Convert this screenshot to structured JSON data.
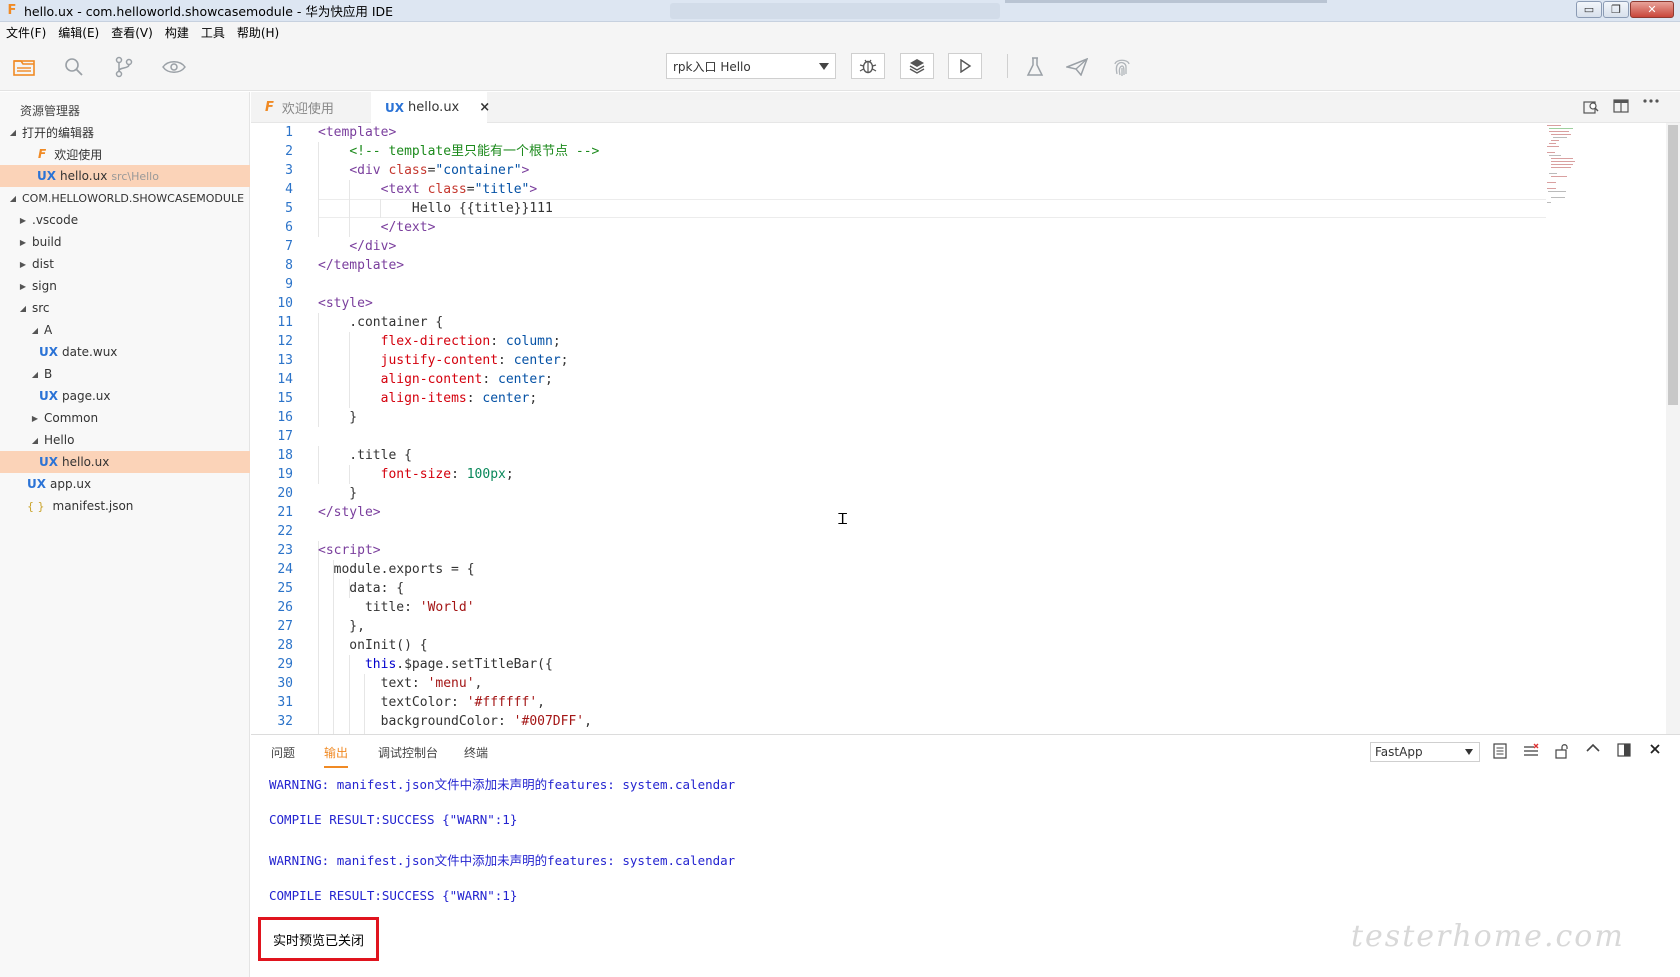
{
  "window": {
    "title": "hello.ux - com.helloworld.showcasemodule - 华为快应用 IDE",
    "app_icon": "F",
    "controls": {
      "minimize": "▭",
      "restore": "❐",
      "close": "✕"
    }
  },
  "menu": [
    "文件(F)",
    "编辑(E)",
    "查看(V)",
    "构建",
    "工具",
    "帮助(H)"
  ],
  "toolbar": {
    "run_target": "rpk入口 Hello"
  },
  "sidebar": {
    "header": "资源管理器",
    "open_editors_label": "打开的编辑器",
    "open_editors": [
      {
        "icon": "F",
        "label": "欢迎使用",
        "path": ""
      },
      {
        "icon": "UX",
        "label": "hello.ux",
        "path": "src\\Hello"
      }
    ],
    "project_label": "COM.HELLOWORLD.SHOWCASEMODULE",
    "tree": [
      {
        "label": ".vscode",
        "type": "folder"
      },
      {
        "label": "build",
        "type": "folder"
      },
      {
        "label": "dist",
        "type": "folder"
      },
      {
        "label": "sign",
        "type": "folder"
      },
      {
        "label": "src",
        "type": "folder-open"
      },
      {
        "label": "A",
        "type": "folder-open"
      },
      {
        "label": "date.wux",
        "type": "ux"
      },
      {
        "label": "B",
        "type": "folder-open"
      },
      {
        "label": "page.ux",
        "type": "ux"
      },
      {
        "label": "Common",
        "type": "folder"
      },
      {
        "label": "Hello",
        "type": "folder-open"
      },
      {
        "label": "hello.ux",
        "type": "ux"
      },
      {
        "label": "app.ux",
        "type": "ux"
      },
      {
        "label": "manifest.json",
        "type": "json"
      }
    ],
    "icons": {
      "ux": "UX",
      "f": "F",
      "json": "{ }"
    }
  },
  "tabs": [
    {
      "icon": "F",
      "label": "欢迎使用"
    },
    {
      "icon": "UX",
      "label": "hello.ux",
      "close": "×"
    }
  ],
  "editor": {
    "line_numbers": [
      "1",
      "2",
      "3",
      "4",
      "5",
      "6",
      "7",
      "8",
      "9",
      "10",
      "11",
      "12",
      "13",
      "14",
      "15",
      "16",
      "17",
      "18",
      "19",
      "20",
      "21",
      "22",
      "23",
      "24",
      "25",
      "26",
      "27",
      "28",
      "29",
      "30",
      "31",
      "32"
    ]
  },
  "panel": {
    "tabs": [
      "问题",
      "输出",
      "调试控制台",
      "终端"
    ],
    "channel": "FastApp",
    "output": [
      "WARNING: manifest.json文件中添加未声明的features: system.calendar",
      "COMPILE RESULT:SUCCESS {\"WARN\":1}",
      "WARNING: manifest.json文件中添加未声明的features: system.calendar",
      "COMPILE RESULT:SUCCESS {\"WARN\":1}"
    ],
    "toast": "实时预览已关闭",
    "watermark": "testerhome.com"
  },
  "colors": {
    "accent": "#f08a24",
    "selection": "#fbd3b8",
    "highlight_border": "#e0141e",
    "output_text": "#2424d0"
  }
}
